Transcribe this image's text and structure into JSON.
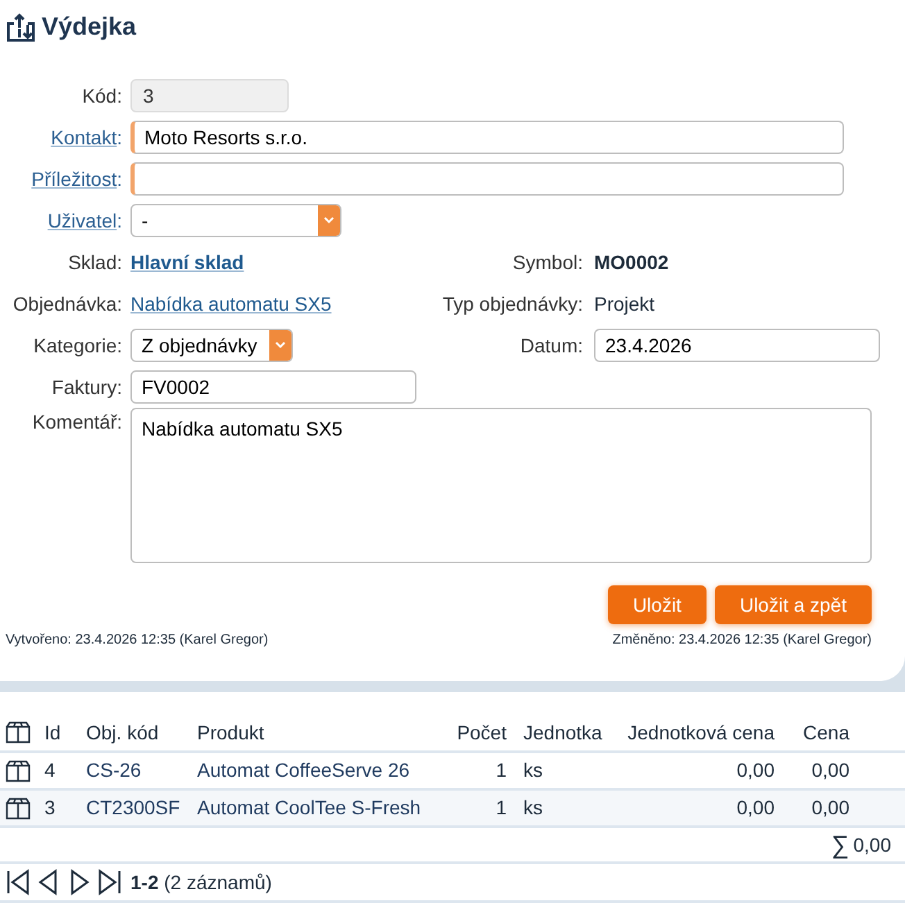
{
  "title": "Výdejka",
  "rows": [
    {
      "left": {
        "label": "Kód:",
        "linked": false,
        "kind": "readonly",
        "value": "3"
      }
    },
    {
      "left": {
        "label": "Kontakt",
        "colon": ":",
        "linked": true,
        "kind": "text",
        "required": true,
        "value": "Moto Resorts s.r.o."
      }
    },
    {
      "left": {
        "label": "Příležitost",
        "colon": ":",
        "linked": true,
        "kind": "text",
        "required": true
      }
    },
    {
      "left": {
        "label": "Uživatel",
        "colon": ":",
        "linked": true,
        "kind": "select",
        "value": "-"
      }
    },
    {
      "left": {
        "label": "Sklad:",
        "linked": false,
        "kind": "link",
        "bold": true,
        "value": "Hlavní sklad"
      },
      "right": {
        "label": "Symbol:",
        "kind": "plain",
        "bold": true,
        "value": "MO0002"
      }
    },
    {
      "left": {
        "label": "Objednávka:",
        "linked": false,
        "kind": "link",
        "bold": false,
        "value": "Nabídka automatu SX5"
      },
      "right": {
        "label": "Typ objednávky:",
        "kind": "plain",
        "bold": false,
        "value": "Projekt"
      }
    },
    {
      "left": {
        "label": "Kategorie:",
        "linked": false,
        "kind": "select",
        "value": "Z objednávky"
      },
      "right": {
        "label": "Datum:",
        "kind": "text",
        "required": false,
        "value": "23.4.2026"
      }
    },
    {
      "left": {
        "label": "Faktury:",
        "linked": false,
        "kind": "text",
        "required": false,
        "value": "FV0002"
      }
    },
    {
      "left": {
        "label": "Komentář:",
        "linked": false,
        "kind": "textarea",
        "value": "Nabídka automatu SX5"
      }
    }
  ],
  "buttons": [
    "Uložit",
    "Uložit a zpět"
  ],
  "created": "Vytvořeno: 23.4.2026 12:35 (Karel Gregor)",
  "changed": "Změněno: 23.4.2026 12:35 (Karel Gregor)",
  "table": {
    "columns": [
      "Id",
      "Obj. kód",
      "Produkt",
      "Počet",
      "Jednotka",
      "Jednotková cena",
      "Cena"
    ],
    "rows": [
      [
        "4",
        "CS-26",
        "Automat CoffeeServe 26",
        "1",
        "ks",
        "0,00",
        "0,00"
      ],
      [
        "3",
        "CT2300SF",
        "Automat CoolTee S-Fresh",
        "1",
        "ks",
        "0,00",
        "0,00"
      ]
    ],
    "sum_sign": "∑",
    "sum": "0,00"
  },
  "pager": {
    "range": "1-2",
    "count": "(2 záznamů)"
  }
}
